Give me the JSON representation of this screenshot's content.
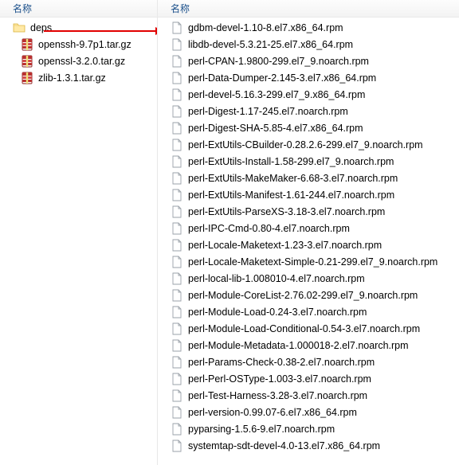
{
  "left": {
    "header": "名称",
    "items": [
      {
        "type": "folder",
        "label": "deps"
      },
      {
        "type": "archive",
        "label": "openssh-9.7p1.tar.gz"
      },
      {
        "type": "archive",
        "label": "openssl-3.2.0.tar.gz"
      },
      {
        "type": "archive",
        "label": "zlib-1.3.1.tar.gz"
      }
    ]
  },
  "right": {
    "header": "名称",
    "items": [
      "gdbm-devel-1.10-8.el7.x86_64.rpm",
      "libdb-devel-5.3.21-25.el7.x86_64.rpm",
      "perl-CPAN-1.9800-299.el7_9.noarch.rpm",
      "perl-Data-Dumper-2.145-3.el7.x86_64.rpm",
      "perl-devel-5.16.3-299.el7_9.x86_64.rpm",
      "perl-Digest-1.17-245.el7.noarch.rpm",
      "perl-Digest-SHA-5.85-4.el7.x86_64.rpm",
      "perl-ExtUtils-CBuilder-0.28.2.6-299.el7_9.noarch.rpm",
      "perl-ExtUtils-Install-1.58-299.el7_9.noarch.rpm",
      "perl-ExtUtils-MakeMaker-6.68-3.el7.noarch.rpm",
      "perl-ExtUtils-Manifest-1.61-244.el7.noarch.rpm",
      "perl-ExtUtils-ParseXS-3.18-3.el7.noarch.rpm",
      "perl-IPC-Cmd-0.80-4.el7.noarch.rpm",
      "perl-Locale-Maketext-1.23-3.el7.noarch.rpm",
      "perl-Locale-Maketext-Simple-0.21-299.el7_9.noarch.rpm",
      "perl-local-lib-1.008010-4.el7.noarch.rpm",
      "perl-Module-CoreList-2.76.02-299.el7_9.noarch.rpm",
      "perl-Module-Load-0.24-3.el7.noarch.rpm",
      "perl-Module-Load-Conditional-0.54-3.el7.noarch.rpm",
      "perl-Module-Metadata-1.000018-2.el7.noarch.rpm",
      "perl-Params-Check-0.38-2.el7.noarch.rpm",
      "perl-Perl-OSType-1.003-3.el7.noarch.rpm",
      "perl-Test-Harness-3.28-3.el7.noarch.rpm",
      "perl-version-0.99.07-6.el7.x86_64.rpm",
      "pyparsing-1.5.6-9.el7.noarch.rpm",
      "systemtap-sdt-devel-4.0-13.el7.x86_64.rpm"
    ]
  }
}
